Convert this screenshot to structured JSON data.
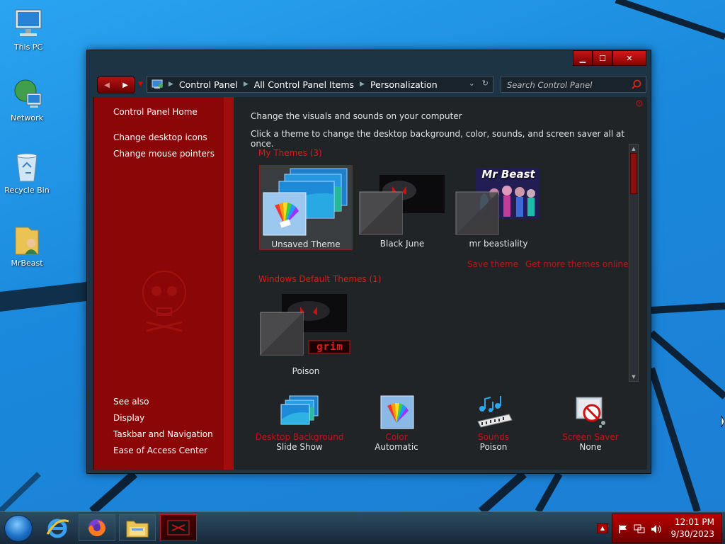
{
  "desktop": {
    "icons": [
      {
        "label": "This PC",
        "icon": "computer-icon"
      },
      {
        "label": "Network",
        "icon": "network-icon"
      },
      {
        "label": "Recycle Bin",
        "icon": "recycle-bin-icon"
      },
      {
        "label": "MrBeast",
        "icon": "user-folder-icon"
      }
    ]
  },
  "window": {
    "controls": {
      "minimize": "▁",
      "maximize": "☐",
      "close": "✕"
    },
    "nav": {
      "back": "◀",
      "forward": "▶",
      "recent": "▼"
    },
    "breadcrumb": [
      "Control Panel",
      "All Control Panel Items",
      "Personalization"
    ],
    "search": {
      "placeholder": "Search Control Panel"
    },
    "left_pane": {
      "home": "Control Panel Home",
      "links": [
        "Change desktop icons",
        "Change mouse pointers"
      ],
      "see_also_heading": "See also",
      "see_also": [
        "Display",
        "Taskbar and Navigation",
        "Ease of Access Center"
      ]
    },
    "content": {
      "heading": "Change the visuals and sounds on your computer",
      "subheading": "Click a theme to change the desktop background, color, sounds, and screen saver all at once.",
      "my_themes_heading": "My Themes (3)",
      "my_themes": [
        {
          "name": "Unsaved Theme",
          "selected": true
        },
        {
          "name": "Black June",
          "selected": false
        },
        {
          "name": "mr beastiality",
          "selected": false,
          "thumb_text": "Mr Beast"
        }
      ],
      "save_theme": "Save theme",
      "get_more": "Get more themes online",
      "default_heading": "Windows Default Themes (1)",
      "default_themes": [
        {
          "name": "Poison",
          "badge": "grim"
        }
      ],
      "bottom": [
        {
          "title": "Desktop Background",
          "value": "Slide Show",
          "icon": "desktop-background-icon"
        },
        {
          "title": "Color",
          "value": "Automatic",
          "icon": "color-palette-icon"
        },
        {
          "title": "Sounds",
          "value": "Poison",
          "icon": "sounds-icon"
        },
        {
          "title": "Screen Saver",
          "value": "None",
          "icon": "screen-saver-icon"
        }
      ]
    }
  },
  "taskbar": {
    "pinned": [
      "internet-explorer-icon",
      "firefox-icon",
      "file-explorer-icon",
      "personalization-icon"
    ],
    "tray_expand": "▲",
    "clock": {
      "time": "12:01 PM",
      "date": "9/30/2023"
    }
  },
  "colors": {
    "accent_red": "#8b0606",
    "link_red": "#c21414",
    "desktop_blue": "#1f8fe0"
  }
}
